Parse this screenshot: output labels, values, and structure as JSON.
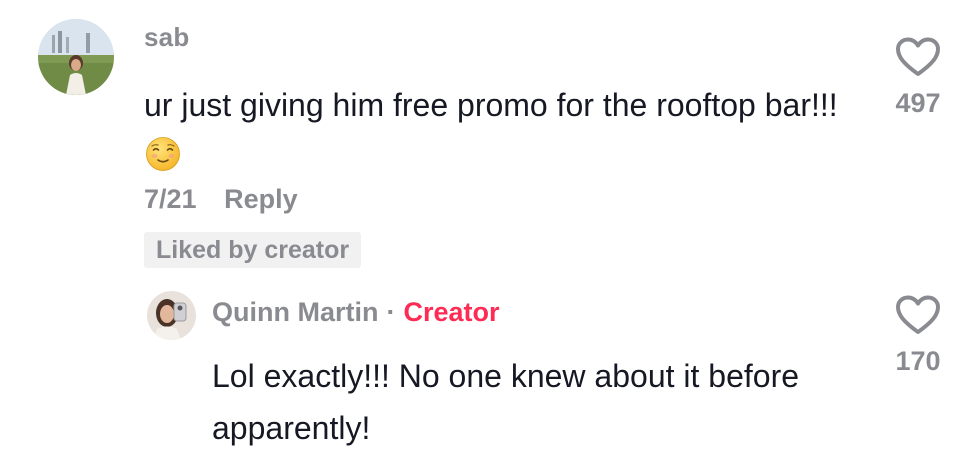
{
  "comment": {
    "username": "sab",
    "text": "ur just giving him free promo for the rooftop bar!!!",
    "emoji": "relieved-face",
    "date": "7/21",
    "reply_label": "Reply",
    "liked_by_creator": "Liked by creator",
    "like_count": "497"
  },
  "reply": {
    "username": "Quinn Martin",
    "separator": "·",
    "creator_tag": "Creator",
    "text": "Lol exactly!!! No one knew about it before apparently!",
    "like_count": "170"
  },
  "colors": {
    "creator_accent": "#fe2c55",
    "muted_text": "#8a8b91",
    "primary_text": "#161823",
    "badge_bg": "#f1f1f2"
  },
  "icons": {
    "like": "heart-outline-icon"
  }
}
